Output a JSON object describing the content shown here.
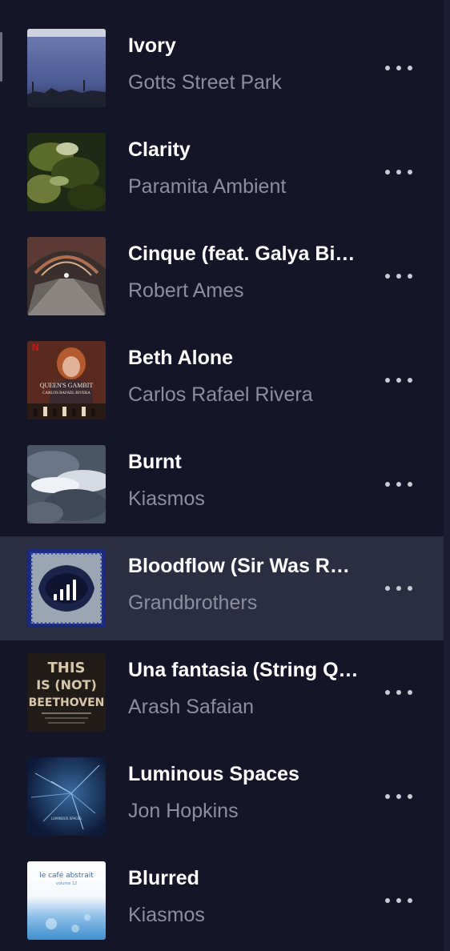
{
  "tracks": [
    {
      "title": "Ivory",
      "artist": "Gotts Street Park",
      "active": false
    },
    {
      "title": "Clarity",
      "artist": "Paramita Ambient",
      "active": false
    },
    {
      "title": "Cinque (feat. Galya Bisengalieva)",
      "artist": "Robert Ames",
      "active": false
    },
    {
      "title": "Beth Alone",
      "artist": "Carlos Rafael Rivera",
      "active": false
    },
    {
      "title": "Burnt",
      "artist": "Kiasmos",
      "active": false
    },
    {
      "title": "Bloodflow (Sir Was Remix)",
      "artist": "Grandbrothers",
      "active": true
    },
    {
      "title": "Una fantasia (String Quartet)",
      "artist": "Arash Safaian",
      "active": false
    },
    {
      "title": "Luminous Spaces",
      "artist": "Jon Hopkins",
      "active": false
    },
    {
      "title": "Blurred",
      "artist": "Kiasmos",
      "active": false
    }
  ],
  "covers": {
    "beth_alone": {
      "brand": "N",
      "line1": "QUEEN'S GAMBIT",
      "line2": "CARLOS RAFAEL RIVERA"
    },
    "una_fantasia": {
      "lines": [
        "THIS",
        "IS (NOT)",
        "BEETHOVEN"
      ]
    },
    "luminous_spaces": {
      "text": "LUMINOUS SPACES"
    },
    "blurred": {
      "line1": "le café abstrait",
      "line2": "volume 12"
    }
  },
  "colors": {
    "background": "#141529",
    "active_row": "#2b2d42",
    "title": "#ffffff",
    "artist": "#8c8ea0",
    "more_dots": "#c9cad4"
  },
  "icons": {
    "more": "more-horizontal-icon",
    "playing": "now-playing-bars-icon"
  }
}
